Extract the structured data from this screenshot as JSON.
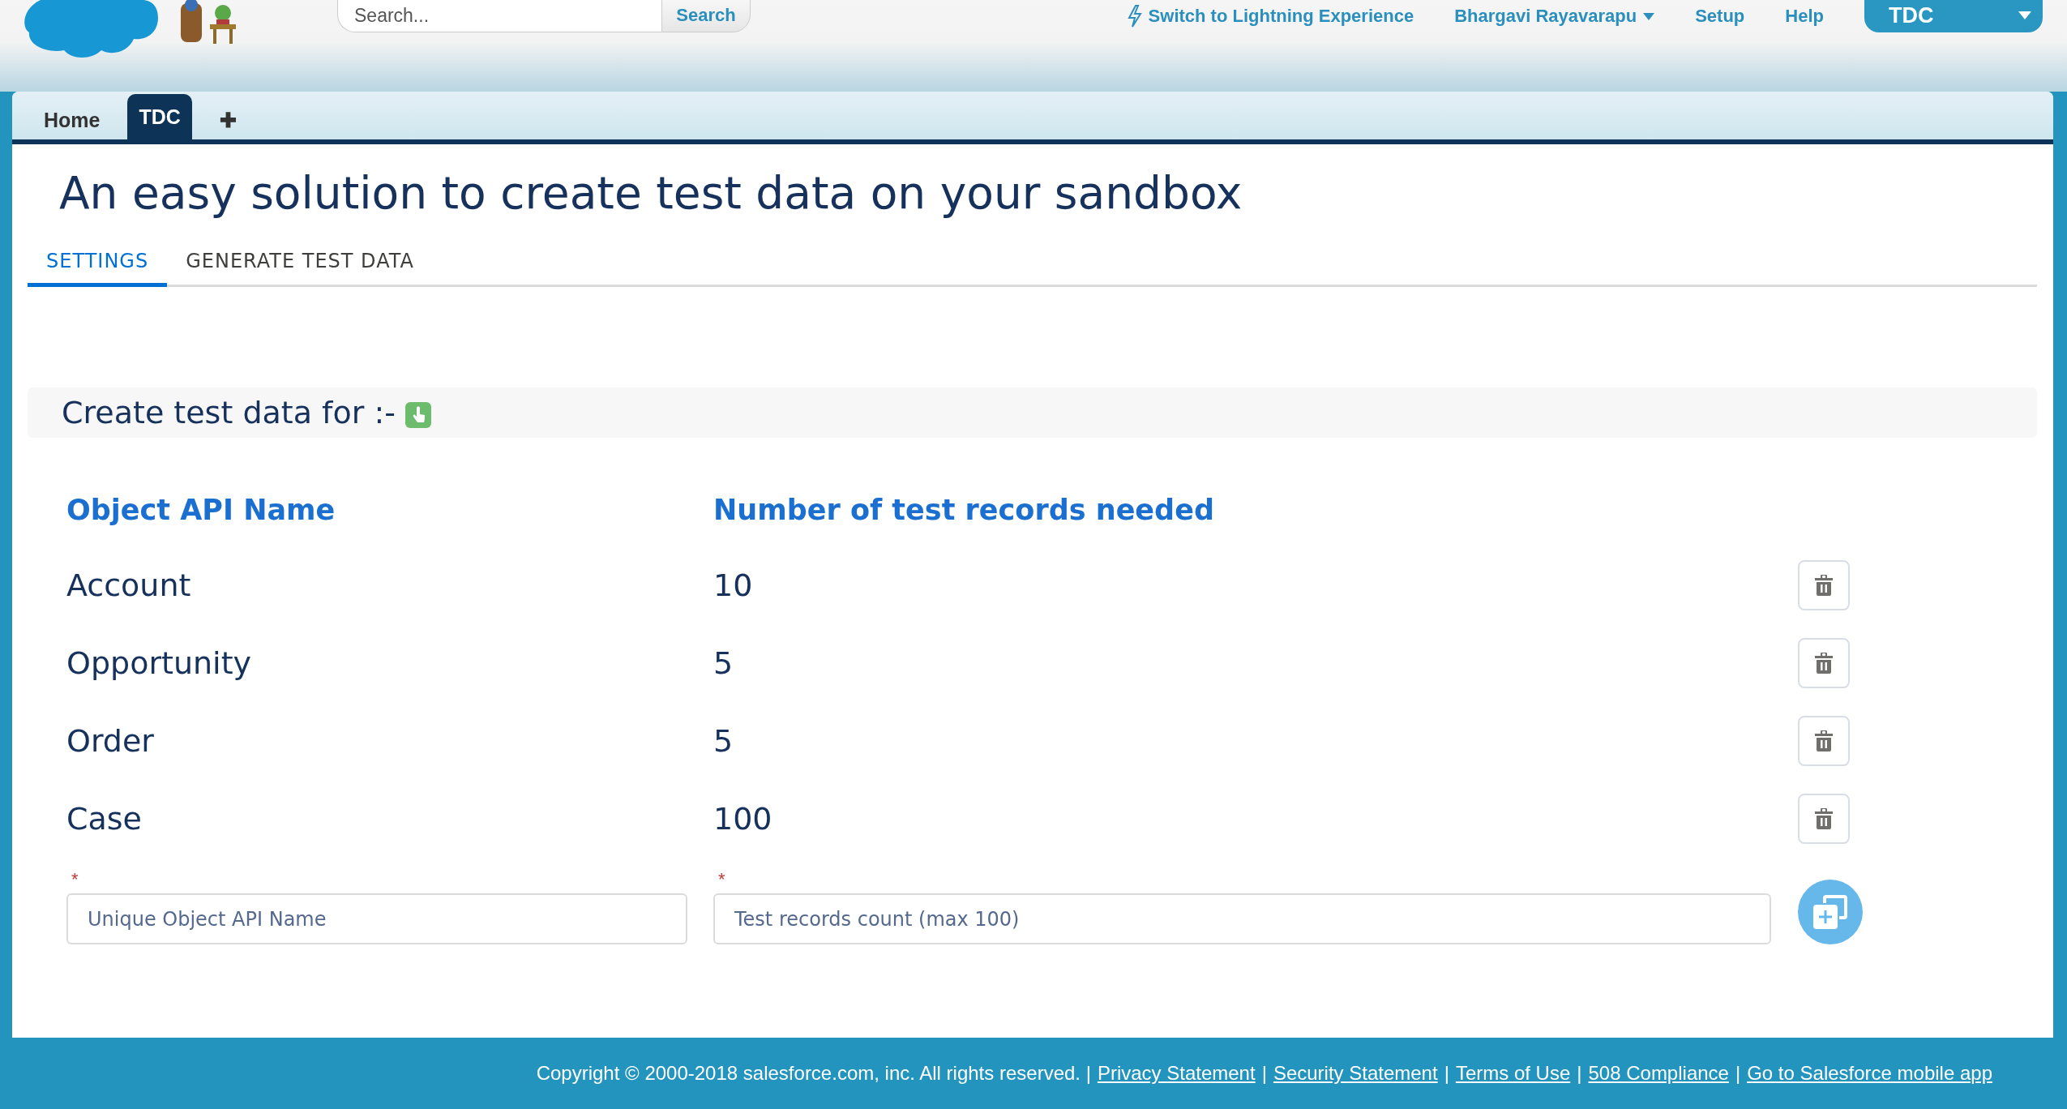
{
  "header": {
    "search": {
      "placeholder": "Search...",
      "button": "Search"
    },
    "links": [
      {
        "kind": "lightning",
        "label": "Switch to Lightning Experience"
      },
      {
        "kind": "menu",
        "label": "Bhargavi Rayavarapu"
      },
      {
        "kind": "plain",
        "label": "Setup"
      },
      {
        "kind": "plain",
        "label": "Help"
      }
    ],
    "app_menu": {
      "label": "TDC"
    }
  },
  "app_tabs": [
    {
      "label": "Home",
      "selected": false
    },
    {
      "label": "TDC",
      "selected": true
    },
    {
      "label": "✚",
      "selected": false
    }
  ],
  "page": {
    "title": "An easy solution to create test data on your sandbox",
    "tabs": [
      {
        "label": "SETTINGS",
        "selected": true
      },
      {
        "label": "GENERATE TEST DATA",
        "selected": false
      }
    ],
    "section_title": "Create test data for :-",
    "table": {
      "columns": [
        "Object API Name",
        "Number of test records needed"
      ],
      "rows": [
        {
          "object": "Account",
          "count": "10"
        },
        {
          "object": "Opportunity",
          "count": "5"
        },
        {
          "object": "Order",
          "count": "5"
        },
        {
          "object": "Case",
          "count": "100"
        }
      ]
    },
    "new_row": {
      "required_mark": "*",
      "object_field": {
        "placeholder": "Unique Object API Name"
      },
      "count_field": {
        "placeholder": "Test records count (max 100)"
      }
    }
  },
  "footer": {
    "text": "Copyright © 2000-2018 salesforce.com, inc. All rights reserved. |",
    "links": [
      "Privacy Statement",
      "Security Statement",
      "Terms of Use",
      "508 Compliance",
      "Go to Salesforce mobile app"
    ],
    "separator": "|"
  }
}
